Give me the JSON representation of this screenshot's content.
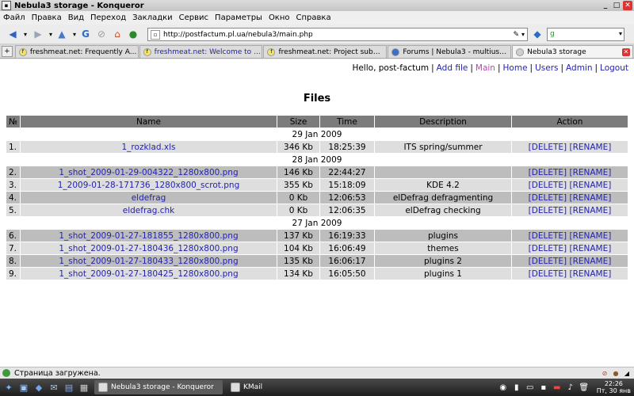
{
  "window": {
    "title": "Nebula3 storage - Konqueror"
  },
  "menu": [
    "Файл",
    "Правка",
    "Вид",
    "Переход",
    "Закладки",
    "Сервис",
    "Параметры",
    "Окно",
    "Справка"
  ],
  "address": {
    "url": "http://postfactum.pl.ua/nebula3/main.php"
  },
  "tabs": [
    {
      "label": "freshmeat.net: Frequently A...",
      "icon": "freshmeat-icon",
      "link": false
    },
    {
      "label": "freshmeat.net: Welcome to f...",
      "icon": "freshmeat-icon",
      "link": true
    },
    {
      "label": "freshmeat.net: Project subm...",
      "icon": "freshmeat-icon",
      "link": false
    },
    {
      "label": "Forums | Nebula3 - multiuse...",
      "icon": "forum-icon",
      "link": false
    },
    {
      "label": "Nebula3 storage",
      "icon": "nebula-icon",
      "link": false,
      "active": true
    }
  ],
  "topnav": {
    "greeting": "Hello, post-factum",
    "links": [
      "Add file",
      "Main",
      "Home",
      "Users",
      "Admin",
      "Logout"
    ],
    "current": "Main"
  },
  "page": {
    "title": "Files"
  },
  "table": {
    "headers": [
      "№",
      "Name",
      "Size",
      "Time",
      "Description",
      "Action"
    ],
    "action_delete": "[DELETE]",
    "action_rename": "[RENAME]",
    "groups": [
      {
        "date": "29 Jan 2009",
        "rows": [
          {
            "num": "1.",
            "name": "1_rozklad.xls",
            "size": "346 Kb",
            "time": "18:25:39",
            "desc": "ITS spring/summer"
          }
        ]
      },
      {
        "date": "28 Jan 2009",
        "rows": [
          {
            "num": "2.",
            "name": "1_shot_2009-01-29-004322_1280x800.png",
            "size": "146 Kb",
            "time": "22:44:27",
            "desc": ""
          },
          {
            "num": "3.",
            "name": "1_2009-01-28-171736_1280x800_scrot.png",
            "size": "355 Kb",
            "time": "15:18:09",
            "desc": "KDE 4.2"
          },
          {
            "num": "4.",
            "name": "eldefrag",
            "size": "0 Kb",
            "time": "12:06:53",
            "desc": "elDefrag defragmenting"
          },
          {
            "num": "5.",
            "name": "eldefrag.chk",
            "size": "0 Kb",
            "time": "12:06:35",
            "desc": "elDefrag checking"
          }
        ]
      },
      {
        "date": "27 Jan 2009",
        "rows": [
          {
            "num": "6.",
            "name": "1_shot_2009-01-27-181855_1280x800.png",
            "size": "137 Kb",
            "time": "16:19:33",
            "desc": "plugins"
          },
          {
            "num": "7.",
            "name": "1_shot_2009-01-27-180436_1280x800.png",
            "size": "104 Kb",
            "time": "16:06:49",
            "desc": "themes"
          },
          {
            "num": "8.",
            "name": "1_shot_2009-01-27-180433_1280x800.png",
            "size": "135 Kb",
            "time": "16:06:17",
            "desc": "plugins 2"
          },
          {
            "num": "9.",
            "name": "1_shot_2009-01-27-180425_1280x800.png",
            "size": "134 Kb",
            "time": "16:05:50",
            "desc": "plugins 1"
          }
        ]
      }
    ]
  },
  "status": {
    "text": "Страница загружена."
  },
  "taskbar": {
    "tasks": [
      {
        "label": "Nebula3 storage - Konqueror",
        "active": true
      },
      {
        "label": "KMail",
        "active": false
      }
    ],
    "clock_time": "22:26",
    "clock_date": "Пт, 30 янв"
  }
}
